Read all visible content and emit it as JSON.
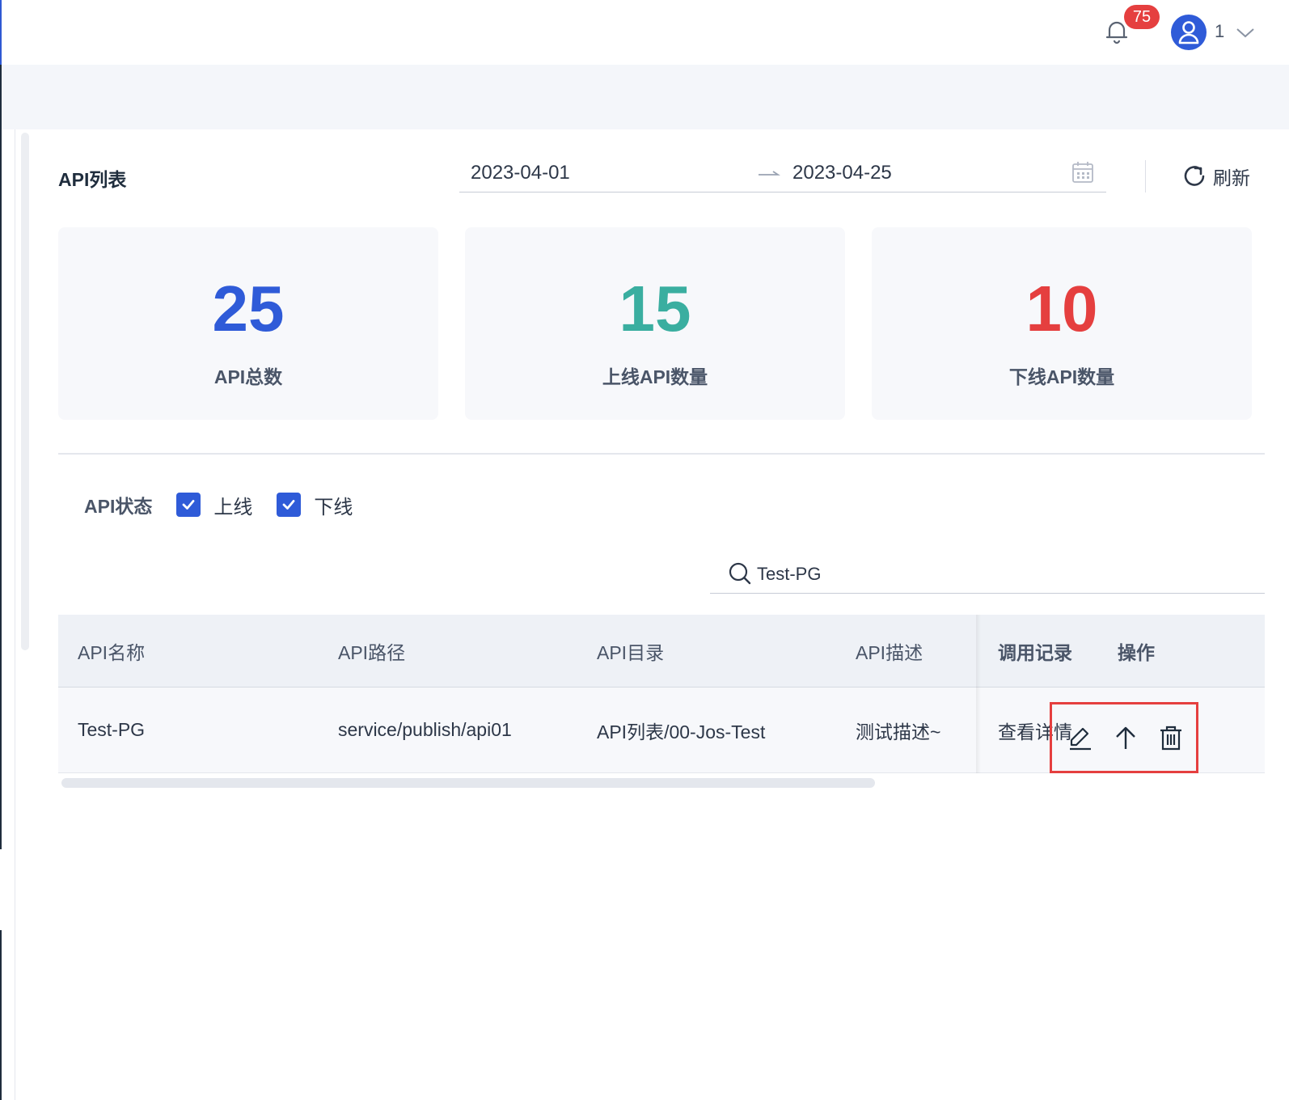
{
  "header": {
    "notification_count": "75",
    "user_name": "1"
  },
  "panel": {
    "title": "API列表",
    "date_start": "2023-04-01",
    "date_end": "2023-04-25",
    "refresh_label": "刷新"
  },
  "stats": [
    {
      "value": "25",
      "label": "API总数",
      "color": "#2f5bd8"
    },
    {
      "value": "15",
      "label": "上线API数量",
      "color": "#3aaea0"
    },
    {
      "value": "10",
      "label": "下线API数量",
      "color": "#e53f3f"
    }
  ],
  "filter": {
    "status_label": "API状态",
    "options": [
      {
        "label": "上线",
        "checked": true
      },
      {
        "label": "下线",
        "checked": true
      }
    ]
  },
  "search": {
    "value": "Test-PG"
  },
  "table": {
    "columns": [
      "API名称",
      "API路径",
      "API目录",
      "API描述",
      "调用记录",
      "操作"
    ],
    "rows": [
      {
        "name": "Test-PG",
        "path": "service/publish/api01",
        "directory": "API列表/00-Jos-Test",
        "description": "测试描述~",
        "call_record": "查看详情",
        "actions": [
          "edit-icon",
          "arrow-up-icon",
          "trash-icon"
        ]
      }
    ]
  },
  "colors": {
    "primary": "#2f5bd8",
    "success": "#3aaea0",
    "danger": "#e53f3f",
    "highlight_border": "#e53f3f"
  }
}
